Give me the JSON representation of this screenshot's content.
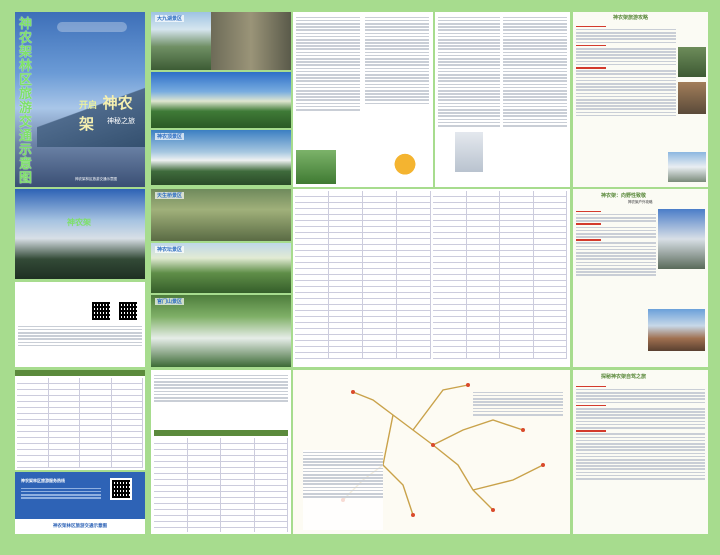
{
  "cover": {
    "vertical_title": "神农架林区旅游交通示意图",
    "slogan_prefix": "开启",
    "slogan_main": "神农架",
    "slogan_sub": "神秘之旅",
    "publisher": "神农架林区旅游交通示意图"
  },
  "sections": {
    "dajiuhu": "大九湖景区",
    "shennongding": "神农顶景区",
    "tiansheng": "天生桥景区",
    "shennongtan": "神农坛景区",
    "guanmenshan": "官门山景区",
    "xiangxi": "香溪源景区"
  },
  "right": {
    "guide_title": "神农架旅游攻略",
    "wild_title": "神农架：向野性致敬",
    "wild_sub": "神农架户外攻略",
    "winter_title": "探秘神农架自驾之旅"
  },
  "banner": {
    "org": "神农架林区旅游服务热线",
    "bottom": "神农架林区旅游交通示意图"
  },
  "colors": {
    "green_accent": "#5b8a3c",
    "title_red": "#d33a2c",
    "sky_blue": "#2f6fc3"
  }
}
